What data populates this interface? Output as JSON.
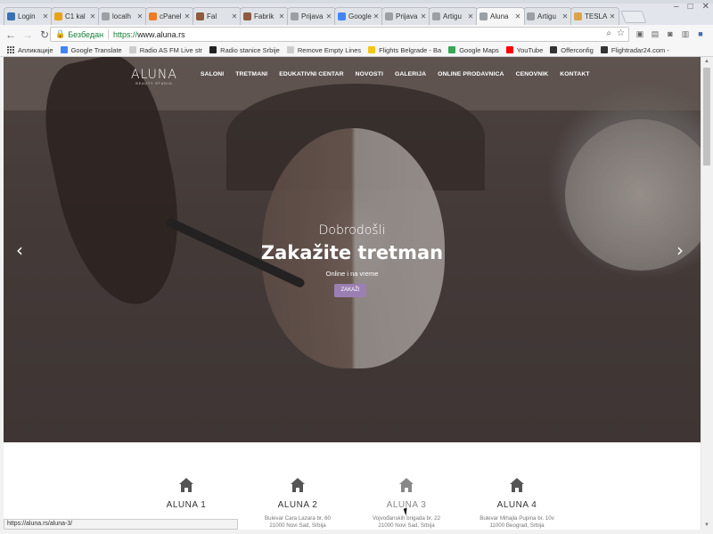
{
  "browser": {
    "tabs": [
      {
        "title": "Login",
        "color": "#3b6fb6",
        "active": false
      },
      {
        "title": "C1 kal",
        "color": "#e8a317",
        "active": false
      },
      {
        "title": "localh",
        "color": "#9aa0a6",
        "active": false
      },
      {
        "title": "cPanel",
        "color": "#f07a22",
        "active": false
      },
      {
        "title": "Fal",
        "color": "#8e5b3e",
        "active": false
      },
      {
        "title": "Fabrik",
        "color": "#8e5b3e",
        "active": false
      },
      {
        "title": "Prijava",
        "color": "#9aa0a6",
        "active": false
      },
      {
        "title": "Google",
        "color": "#4285f4",
        "active": false
      },
      {
        "title": "Prijava",
        "color": "#9aa0a6",
        "active": false
      },
      {
        "title": "Artigu",
        "color": "#9aa0a6",
        "active": false
      },
      {
        "title": "Aluna",
        "color": "#9aa0a6",
        "active": true
      },
      {
        "title": "Artigu",
        "color": "#9aa0a6",
        "active": false
      },
      {
        "title": "TESLA",
        "color": "#d9a44a",
        "active": false
      }
    ],
    "security_label": "Безбедан",
    "url_scheme": "https://",
    "url_host": "www.aluna.rs",
    "bookmarks": [
      {
        "label": "Апликације",
        "color": "#555"
      },
      {
        "label": "Google Translate",
        "color": "#4285f4"
      },
      {
        "label": "Radio AS FM Live str",
        "color": "#cccccc"
      },
      {
        "label": "Radio stanice Srbije",
        "color": "#222222"
      },
      {
        "label": "Remove Empty Lines",
        "color": "#cccccc"
      },
      {
        "label": "Flights Belgrade - Ba",
        "color": "#f5c518"
      },
      {
        "label": "Google Maps",
        "color": "#34a853"
      },
      {
        "label": "YouTube",
        "color": "#ff0000"
      },
      {
        "label": "Offerconfig",
        "color": "#333333"
      },
      {
        "label": "Flightradar24.com -",
        "color": "#333333"
      }
    ],
    "status_url": "https://aluna.rs/aluna-3/"
  },
  "site": {
    "logo": {
      "word": "ALUNA",
      "sub": "BEAUTY STUDIO"
    },
    "nav": [
      "SALONI",
      "TRETMANI",
      "EDUKATIVNI CENTAR",
      "NOVOSTI",
      "GALERIJA",
      "ONLINE PRODAVNICA",
      "CENOVNIK",
      "KONTAKT"
    ],
    "hero": {
      "welcome": "Dobrodošli",
      "headline": "Zakažite tretman",
      "subtitle": "Online i na vreme",
      "cta": "ZAKAŽI",
      "prev": "‹",
      "next": "›"
    },
    "salons": [
      {
        "name": "ALUNA 1",
        "addr1": "",
        "addr2": "",
        "muted": false
      },
      {
        "name": "ALUNA 2",
        "addr1": "Bulevar Cara Lazara br. 60",
        "addr2": "21000 Novi Sad, Srbija",
        "muted": false
      },
      {
        "name": "ALUNA 3",
        "addr1": "Vojvođanskih brigada br. 22",
        "addr2": "21000 Novi Sad, Srbija",
        "muted": true
      },
      {
        "name": "ALUNA 4",
        "addr1": "Bulevar Mihajla Pupina br. 10v",
        "addr2": "11000 Beograd, Srbija",
        "muted": false
      }
    ],
    "accent_color": "#9b7fb2"
  }
}
